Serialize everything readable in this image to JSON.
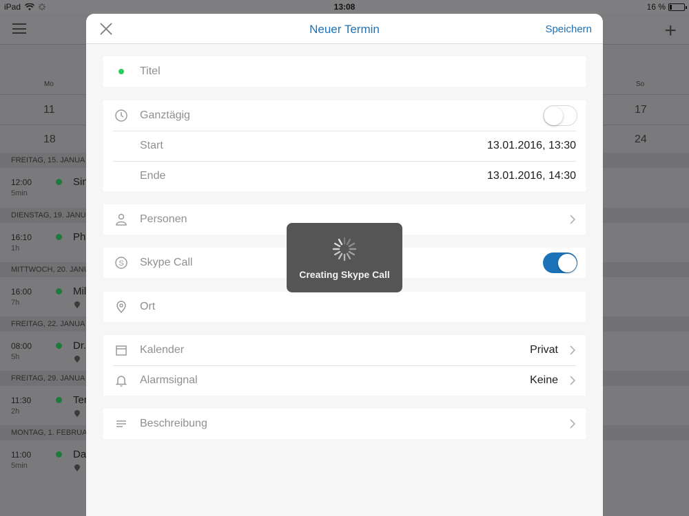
{
  "status_bar": {
    "device": "iPad",
    "time": "13:08",
    "battery": "16 %",
    "battery_level": 0.16
  },
  "calendar": {
    "weekdays": [
      "Mo",
      "So"
    ],
    "week1": [
      "11",
      "17"
    ],
    "week2": [
      "18",
      "24"
    ]
  },
  "agenda": [
    {
      "header": "FREITAG, 15. JANUA",
      "time": "12:00",
      "duration": "5min",
      "title": "Sin",
      "has_location": false
    },
    {
      "header": "DIENSTAG, 19. JANUA",
      "time": "16:10",
      "duration": "1h",
      "title": "Phy",
      "has_location": false
    },
    {
      "header": "MITTWOCH, 20. JANU",
      "time": "16:00",
      "duration": "7h",
      "title": "Mil",
      "has_location": true
    },
    {
      "header": "FREITAG, 22. JANUA",
      "time": "08:00",
      "duration": "5h",
      "title": "Dr.",
      "has_location": true
    },
    {
      "header": "FREITAG, 29. JANUA",
      "time": "11:30",
      "duration": "2h",
      "title": "Ter",
      "has_location": true
    },
    {
      "header": "MONTAG, 1. FEBRUA",
      "time": "11:00",
      "duration": "5min",
      "title": "Da",
      "has_location": true
    }
  ],
  "modal": {
    "title": "Neuer Termin",
    "save_label": "Speichern",
    "title_field_placeholder": "Titel",
    "all_day_label": "Ganztägig",
    "all_day_on": false,
    "start_label": "Start",
    "start_value": "13.01.2016, 13:30",
    "end_label": "Ende",
    "end_value": "13.01.2016, 14:30",
    "people_label": "Personen",
    "skype_label": "Skype Call",
    "skype_on": true,
    "location_label": "Ort",
    "calendar_label": "Kalender",
    "calendar_value": "Privat",
    "alarm_label": "Alarmsignal",
    "alarm_value": "Keine",
    "description_label": "Beschreibung"
  },
  "hud": {
    "message": "Creating Skype Call"
  },
  "colors": {
    "accent": "#1b72b8",
    "green_dot": "#2ecc5f"
  },
  "icons": [
    "wifi-icon",
    "menu-icon",
    "plus-icon",
    "close-icon",
    "clock-icon",
    "person-icon",
    "skype-icon",
    "location-pin-icon",
    "calendar-icon",
    "bell-icon",
    "description-lines-icon",
    "chevron-right-icon",
    "spinner-icon"
  ]
}
